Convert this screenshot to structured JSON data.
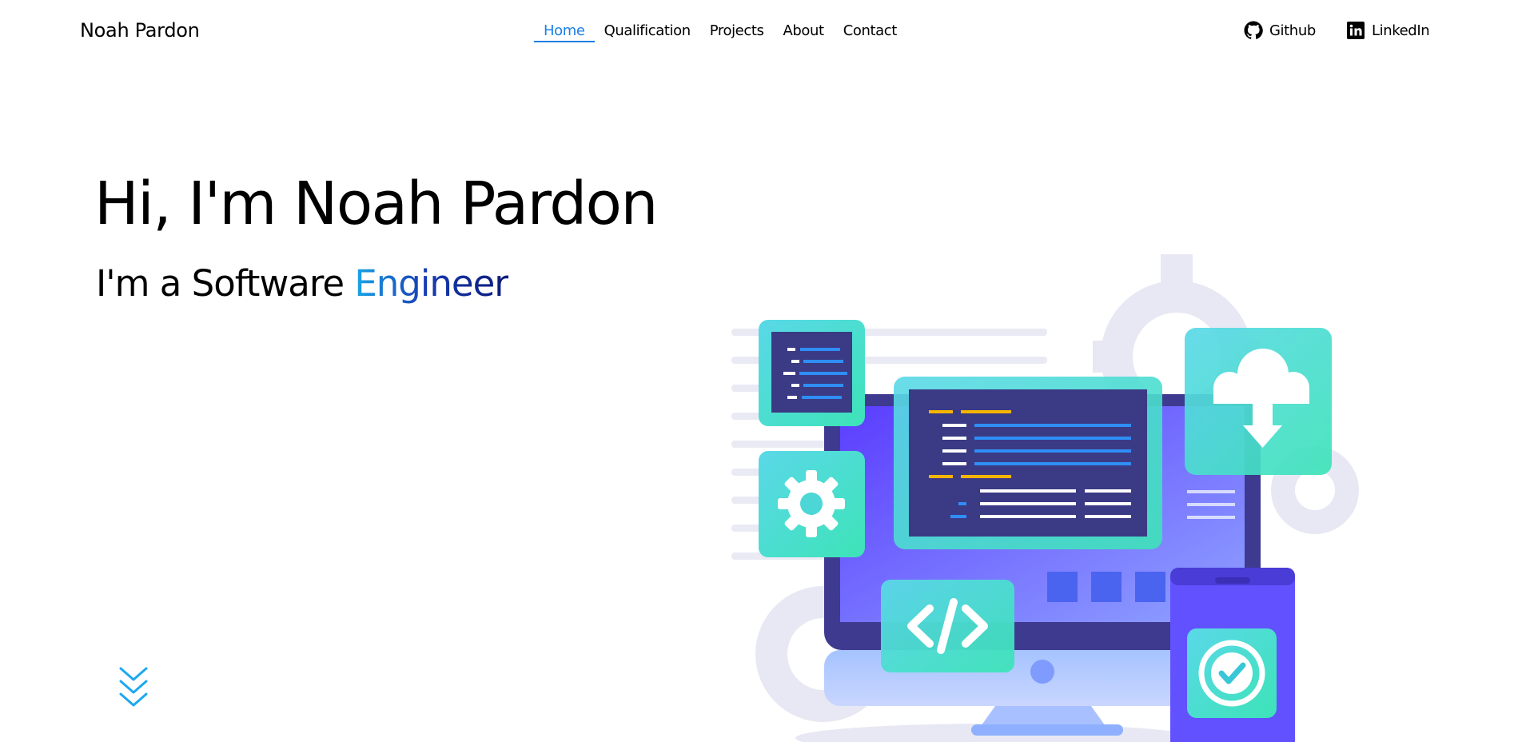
{
  "header": {
    "brand": "Noah Pardon",
    "nav": [
      "Home",
      "Qualification",
      "Projects",
      "About",
      "Contact"
    ],
    "active_index": 0,
    "social": {
      "github": "Github",
      "linkedin": "LinkedIn"
    }
  },
  "hero": {
    "title": "Hi, I'm Noah Pardon",
    "subtitle_prefix": "I'm a Software ",
    "subtitle_role": "Engineer"
  },
  "colors": {
    "accent": "#1a7fe6",
    "scroll_icon": "#1ea7f0"
  },
  "icons": [
    "github-icon",
    "linkedin-icon",
    "chevrons-down-icon"
  ]
}
